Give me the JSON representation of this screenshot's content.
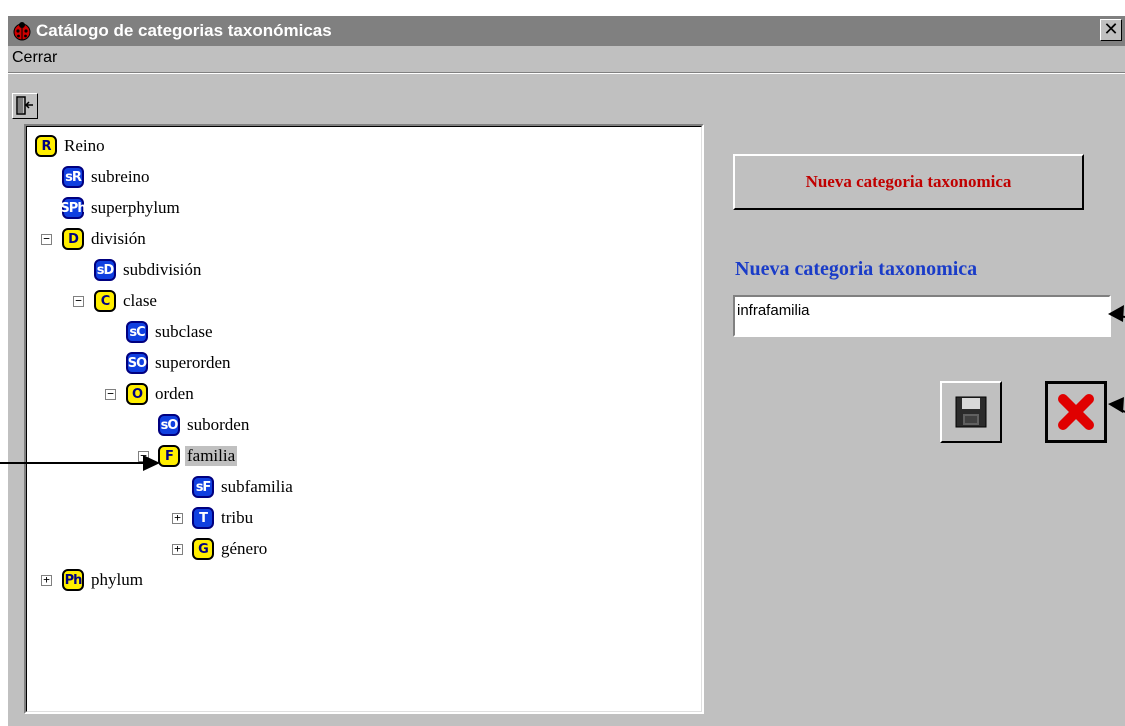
{
  "window": {
    "title": "Catálogo de categorias taxonómicas",
    "close_glyph": "✕"
  },
  "menu": {
    "items": [
      "Cerrar"
    ]
  },
  "toolbar": {
    "exit_icon": "exit-door-icon"
  },
  "tree": {
    "nodes": [
      {
        "label": "Reino",
        "badge": "R",
        "style": "yellow",
        "toggle": null
      },
      {
        "label": "subreino",
        "badge": "sR",
        "style": "blue",
        "toggle": null
      },
      {
        "label": "superphylum",
        "badge": "SPh",
        "style": "blue",
        "toggle": null
      },
      {
        "label": "división",
        "badge": "D",
        "style": "yellow",
        "toggle": "−"
      },
      {
        "label": "subdivisión",
        "badge": "sD",
        "style": "blue",
        "toggle": null
      },
      {
        "label": "clase",
        "badge": "C",
        "style": "yellow",
        "toggle": "−"
      },
      {
        "label": "subclase",
        "badge": "sC",
        "style": "blue",
        "toggle": null
      },
      {
        "label": "superorden",
        "badge": "SO",
        "style": "blue",
        "toggle": null
      },
      {
        "label": "orden",
        "badge": "O",
        "style": "yellow",
        "toggle": "−"
      },
      {
        "label": "suborden",
        "badge": "sO",
        "style": "blue",
        "toggle": null
      },
      {
        "label": "familia",
        "badge": "F",
        "style": "yellow",
        "toggle": "−",
        "selected": true
      },
      {
        "label": "subfamilia",
        "badge": "sF",
        "style": "blue",
        "toggle": null
      },
      {
        "label": "tribu",
        "badge": "T",
        "style": "blue",
        "toggle": "+"
      },
      {
        "label": "género",
        "badge": "G",
        "style": "yellow",
        "toggle": "+"
      },
      {
        "label": "phylum",
        "badge": "Ph",
        "style": "yellow",
        "toggle": "+"
      }
    ]
  },
  "panel": {
    "new_button_label": "Nueva categoria taxonomica",
    "field_label": "Nueva categoria taxonomica",
    "field_value": "infrafamilia",
    "save_icon": "floppy-disk-icon",
    "cancel_icon": "red-x-icon"
  },
  "colors": {
    "title_bar": "#808080",
    "window_bg": "#c0c0c0",
    "button_text": "#c00000",
    "field_label": "#1a3cc8",
    "badge_yellow": "#ffee00",
    "badge_blue": "#1040e0"
  }
}
